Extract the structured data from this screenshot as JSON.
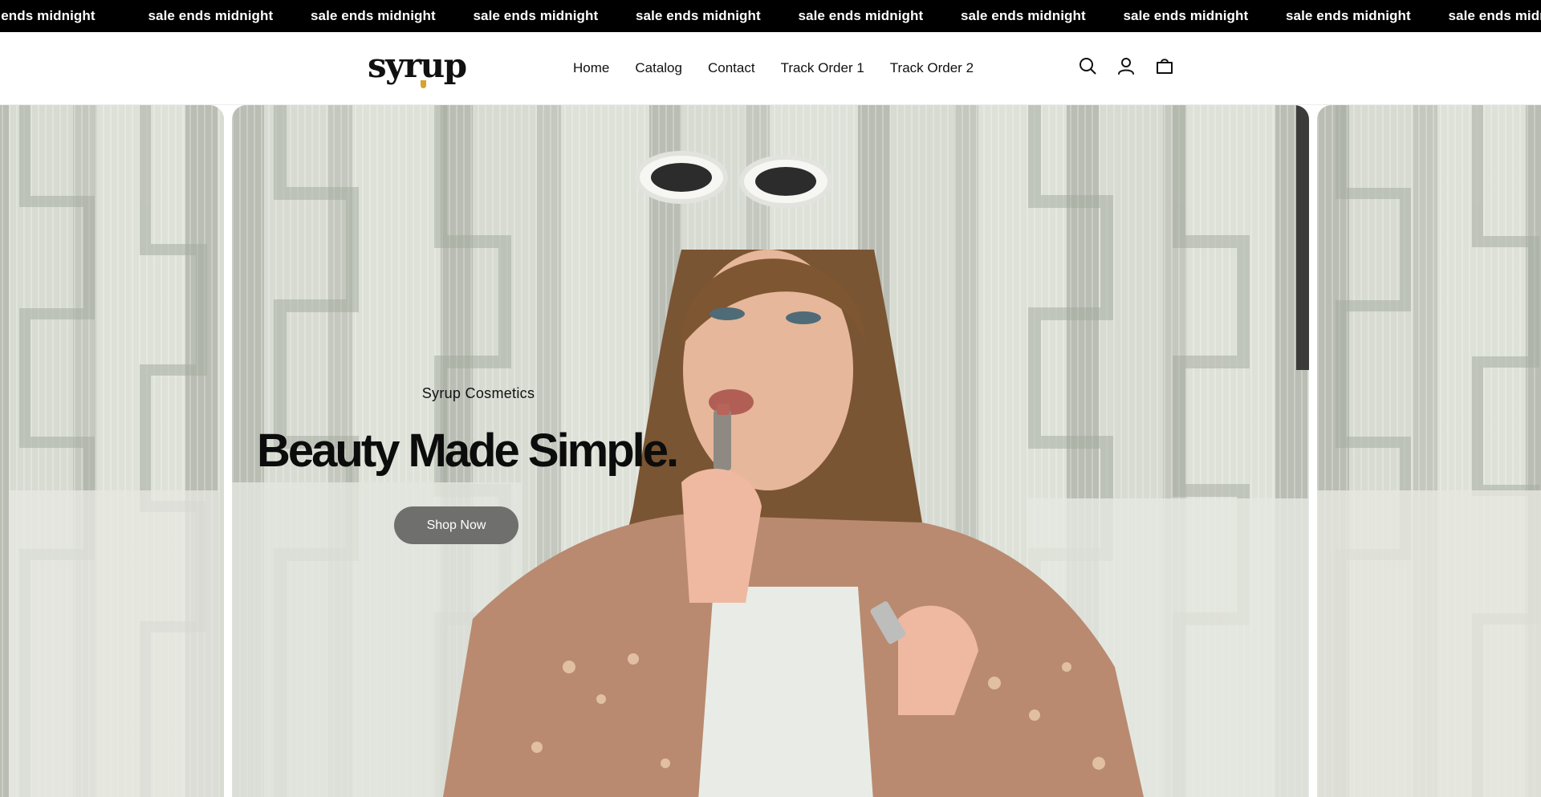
{
  "announcement": {
    "items": [
      "le ends midnight",
      "sale ends midnight",
      "sale ends midnight",
      "sale ends midnight",
      "sale ends midnight",
      "sale ends midnight",
      "sale ends midnight",
      "sale ends midnight",
      "sale ends midnight",
      "sale ends midni"
    ]
  },
  "header": {
    "logo_text": "syrup",
    "nav": [
      {
        "label": "Home"
      },
      {
        "label": "Catalog"
      },
      {
        "label": "Contact"
      },
      {
        "label": "Track Order 1"
      },
      {
        "label": "Track Order 2"
      }
    ],
    "icons": [
      "search-icon",
      "account-icon",
      "cart-icon"
    ]
  },
  "hero": {
    "subheading": "Syrup Cosmetics",
    "heading": "Beauty Made Simple.",
    "button_label": "Shop Now"
  },
  "colors": {
    "announcement_bg": "#000000",
    "button_bg": "#6f6f6d",
    "logo_accent": "#d8a22e"
  }
}
